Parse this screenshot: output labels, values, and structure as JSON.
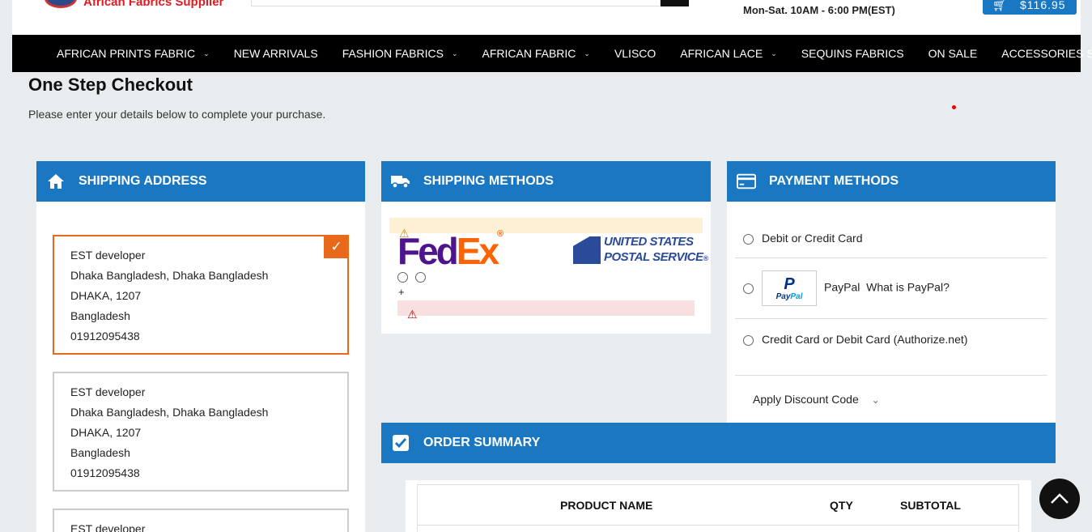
{
  "header": {
    "logo_text": "African Fabrics Supplier",
    "hours": "Mon-Sat. 10AM - 6:00 PM(EST)",
    "cart_total": "$116.95"
  },
  "nav": {
    "items": [
      {
        "label": "AFRICAN PRINTS FABRIC",
        "dropdown": true
      },
      {
        "label": "NEW ARRIVALS",
        "dropdown": false
      },
      {
        "label": "FASHION FABRICS",
        "dropdown": true
      },
      {
        "label": "AFRICAN FABRIC",
        "dropdown": true
      },
      {
        "label": "VLISCO",
        "dropdown": false
      },
      {
        "label": "AFRICAN LACE",
        "dropdown": true
      },
      {
        "label": "SEQUINS FABRICS",
        "dropdown": false
      },
      {
        "label": "ON SALE",
        "dropdown": false
      },
      {
        "label": "ACCESSORIES SHOP",
        "dropdown": true
      }
    ]
  },
  "page": {
    "title": "One Step Checkout",
    "subtitle": "Please enter your details below to complete your purchase."
  },
  "shipping_address": {
    "heading": "SHIPPING ADDRESS",
    "addresses": [
      {
        "name": "EST developer",
        "street": "Dhaka Bangladesh, Dhaka Bangladesh",
        "city": "DHAKA, 1207",
        "country": "Bangladesh",
        "phone": "01912095438",
        "selected": true
      },
      {
        "name": "EST developer",
        "street": "Dhaka Bangladesh, Dhaka Bangladesh",
        "city": "DHAKA, 1207",
        "country": "Bangladesh",
        "phone": "01912095438",
        "selected": false
      },
      {
        "name": "EST developer"
      }
    ]
  },
  "shipping_methods": {
    "heading": "SHIPPING METHODS",
    "fedex_fe": "Fed",
    "fedex_ex": "Ex",
    "fedex_reg": "®",
    "usps_line1": "UNITED STATES",
    "usps_line2": "POSTAL SERVICE",
    "usps_reg": "®",
    "plus": "+"
  },
  "payment_methods": {
    "heading": "PAYMENT METHODS",
    "options": {
      "card": "Debit or Credit Card",
      "paypal": "PayPal",
      "paypal_info": "What is PayPal?",
      "authorize": "Credit Card or Debit Card (Authorize.net)"
    },
    "paypal_logo_mark": "P",
    "paypal_logo_pay": "Pay",
    "paypal_logo_pal": "Pal",
    "discount": "Apply Discount Code"
  },
  "order_summary": {
    "heading": "ORDER SUMMARY",
    "columns": [
      "PRODUCT NAME",
      "QTY",
      "SUBTOTAL"
    ]
  },
  "colors": {
    "accent": "#1a78c2",
    "selected_border": "#e8681c",
    "nav_bg": "#000000"
  }
}
